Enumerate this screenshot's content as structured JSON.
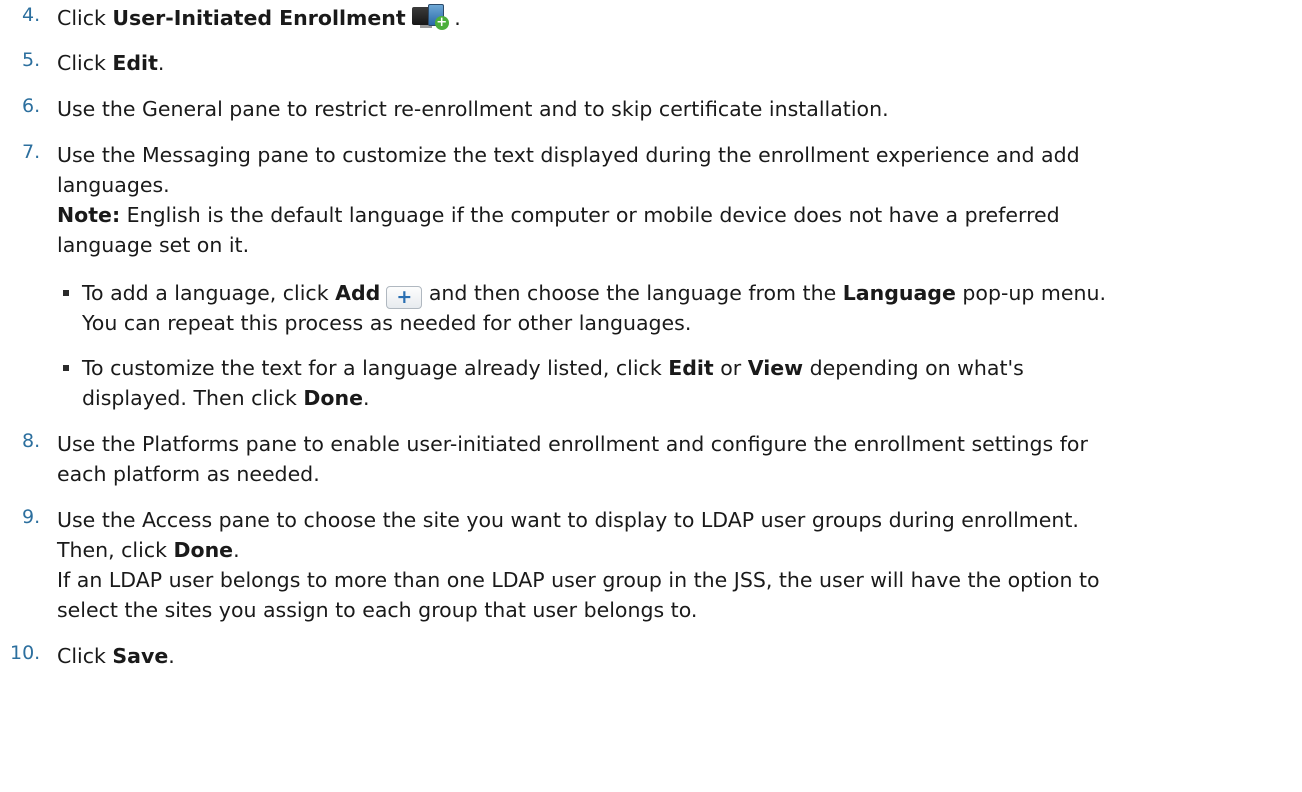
{
  "steps": [
    {
      "num": "4.",
      "parts": [
        "Click ",
        "User-Initiated Enrollment",
        " ."
      ]
    },
    {
      "num": "5.",
      "parts": [
        "Click ",
        "Edit",
        "."
      ]
    },
    {
      "num": "6.",
      "text": "Use the General pane to restrict re-enrollment and to skip certificate installation."
    },
    {
      "num": "7.",
      "line1": "Use the Messaging pane to customize the text displayed during the enrollment experience and add",
      "line2": "languages.",
      "note_label": "Note:",
      "note_text1": " English is the default language if the computer or mobile device does not have a preferred",
      "note_text2": "language set on it."
    },
    {
      "num": "8.",
      "line1": "Use the Platforms pane to enable user-initiated enrollment and configure the enrollment settings for",
      "line2": "each platform as needed."
    },
    {
      "num": "9.",
      "line1_a": "Use the Access pane to choose the site you want to display to LDAP user groups during enrollment.",
      "line2_a": "Then, click ",
      "line2_b": "Done",
      "line2_c": ".",
      "line3": "If an LDAP user belongs to more than one LDAP user group in the JSS, the user will have the option to",
      "line4": "select the sites you assign to each group that user belongs to."
    },
    {
      "num": "10.",
      "parts": [
        "Click ",
        "Save",
        "."
      ]
    }
  ],
  "bullets": [
    {
      "a": "To add a language, click ",
      "b": "Add",
      "c": " and then choose the language from the ",
      "d": "Language",
      "e": " pop-up menu.",
      "line2": "You can repeat this process as needed for other languages."
    },
    {
      "a": "To customize the text for a language already listed, click ",
      "b": "Edit",
      "c": " or ",
      "d": "View",
      "e": " depending on what's",
      "line2_a": "displayed. Then click ",
      "line2_b": "Done",
      "line2_c": "."
    }
  ],
  "icons": {
    "enrollment": "user-initiated-enrollment-icon",
    "add": "add-plus-icon",
    "add_glyph": "+",
    "enroll_plus_glyph": "+"
  },
  "colors": {
    "step_number": "#2c6f9e",
    "text": "#1a1a1a"
  }
}
